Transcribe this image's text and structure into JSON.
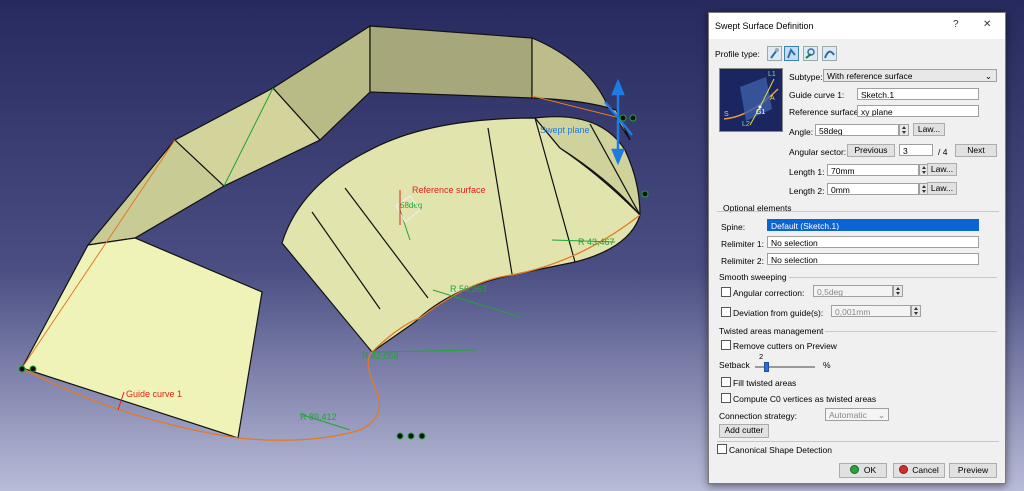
{
  "viewport": {
    "labels": {
      "reference_surface": "Reference surface",
      "swept_plane": "Swept plane",
      "guide_curve": "Guide curve 1",
      "r_43": "R 43,467",
      "r_56": "R 56,363",
      "r_42": "R 42,058",
      "r_89": "R 89,412",
      "angle_tag": "58deg"
    },
    "colors": {
      "background_top": "#2a2e63",
      "background_bottom": "#b9bcd8",
      "surface_light": "#f0f3b8",
      "surface_side": "#d6d8a2",
      "surface_dark": "#a6a77a",
      "construction_green": "#22a336",
      "label_red": "#e0231c",
      "axis_blue": "#1e7be0"
    }
  },
  "dialog": {
    "title": "Swept Surface Definition",
    "help": "?",
    "close": "✕",
    "profile_type_label": "Profile type:",
    "profile_types": [
      "explicit-profile-icon",
      "line-profile-icon",
      "circle-profile-icon",
      "conic-profile-icon"
    ],
    "subtype_label": "Subtype:",
    "subtype_value": "With reference surface",
    "guide_curve_label": "Guide curve 1:",
    "guide_curve_value": "Sketch.1",
    "reference_surface_label": "Reference surface:",
    "reference_surface_value": "xy plane",
    "angle_label": "Angle:",
    "angle_value": "58deg",
    "law_label": "Law...",
    "angular_sector_label": "Angular sector:",
    "previous_label": "Previous",
    "sector_value": "3",
    "sector_total": "/ 4",
    "next_label": "Next",
    "length1_label": "Length 1:",
    "length1_value": "70mm",
    "length2_label": "Length 2:",
    "length2_value": "0mm",
    "optional_elements_label": "Optional elements",
    "spine_label": "Spine:",
    "spine_value": "Default (Sketch.1)",
    "relimiter1_label": "Relimiter 1:",
    "relimiter1_value": "No selection",
    "relimiter2_label": "Relimiter 2:",
    "relimiter2_value": "No selection",
    "smooth_sweeping_label": "Smooth sweeping",
    "angular_correction_label": "Angular correction:",
    "angular_correction_value": "0,5deg",
    "deviation_label": "Deviation from guide(s):",
    "deviation_value": "0,001mm",
    "twisted_areas_label": "Twisted areas management",
    "remove_cutters_label": "Remove cutters on Preview",
    "setback_label": "Setback",
    "setback_value": "2",
    "setback_max": 100,
    "setback_unit": "%",
    "fill_twisted_label": "Fill twisted areas",
    "compute_c0_label": "Compute C0 vertices as twisted areas",
    "connection_strategy_label": "Connection strategy:",
    "connection_strategy_value": "Automatic",
    "add_cutter_label": "Add cutter",
    "canonical_label": "Canonical Shape Detection",
    "ok_label": "OK",
    "cancel_label": "Cancel",
    "preview_label": "Preview",
    "thumb": {
      "l1": "L1",
      "l2": "L2",
      "a": "A",
      "g1": "G1",
      "s": "S"
    }
  }
}
